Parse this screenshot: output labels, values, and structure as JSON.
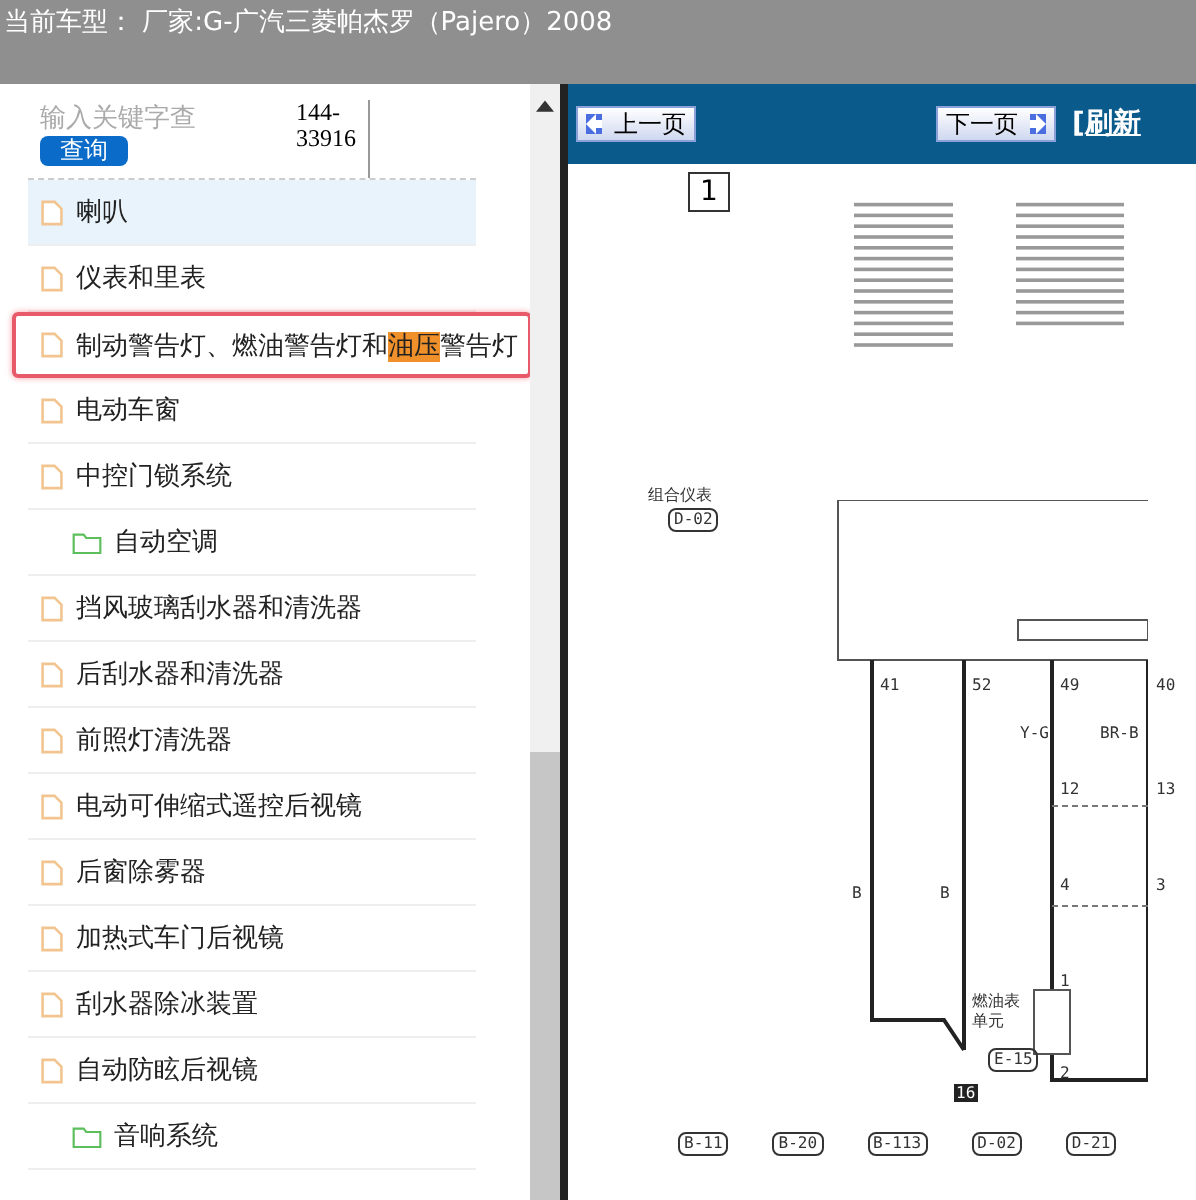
{
  "header": {
    "title": "当前车型： 厂家:G-广汽三菱帕杰罗（Pajero）2008"
  },
  "search": {
    "placeholder": "输入关键字查",
    "button": "查询",
    "code": "144-33916"
  },
  "tree": [
    {
      "kind": "file",
      "label": "喇叭",
      "selected": true,
      "highlighted": false
    },
    {
      "kind": "file",
      "label": "仪表和里表",
      "selected": false,
      "highlighted": false
    },
    {
      "kind": "file",
      "label": "制动警告灯、燃油警告灯和",
      "match": "油压",
      "after": "警告灯",
      "selected": false,
      "highlighted": true
    },
    {
      "kind": "file",
      "label": "电动车窗",
      "selected": false,
      "highlighted": false
    },
    {
      "kind": "file",
      "label": "中控门锁系统",
      "selected": false,
      "highlighted": false
    },
    {
      "kind": "folder",
      "label": "自动空调",
      "selected": false,
      "highlighted": false
    },
    {
      "kind": "file",
      "label": "挡风玻璃刮水器和清洗器",
      "selected": false,
      "highlighted": false
    },
    {
      "kind": "file",
      "label": "后刮水器和清洗器",
      "selected": false,
      "highlighted": false
    },
    {
      "kind": "file",
      "label": "前照灯清洗器",
      "selected": false,
      "highlighted": false
    },
    {
      "kind": "file",
      "label": "电动可伸缩式遥控后视镜",
      "selected": false,
      "highlighted": false
    },
    {
      "kind": "file",
      "label": "后窗除雾器",
      "selected": false,
      "highlighted": false
    },
    {
      "kind": "file",
      "label": "加热式车门后视镜",
      "selected": false,
      "highlighted": false
    },
    {
      "kind": "file",
      "label": "刮水器除冰装置",
      "selected": false,
      "highlighted": false
    },
    {
      "kind": "file",
      "label": "自动防眩后视镜",
      "selected": false,
      "highlighted": false
    },
    {
      "kind": "folder",
      "label": "音响系统",
      "selected": false,
      "highlighted": false
    }
  ],
  "viewer": {
    "prev": "上一页",
    "next": "下一页",
    "refresh": "[刷新",
    "page_number": "1",
    "module": "组合仪表",
    "module_code": "D-02",
    "pins": [
      "41",
      "52",
      "49",
      "40"
    ],
    "wires": [
      "B",
      "B",
      "Y-G",
      "BR-B"
    ],
    "joints": [
      "12",
      "13",
      "4",
      "3"
    ],
    "ground": "16",
    "sensor": "燃油表单元",
    "sensor_code": "E-15",
    "sensor_pins": [
      "1",
      "2"
    ],
    "connectors": [
      "B-11",
      "B-20",
      "B-113",
      "D-02",
      "D-21"
    ]
  }
}
